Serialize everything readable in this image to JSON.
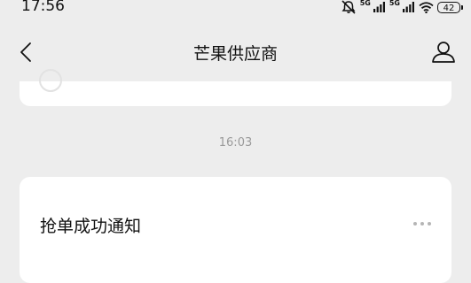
{
  "status_bar": {
    "time": "17:56",
    "network_1": "5G",
    "network_2": "5G",
    "battery": "42",
    "icons": [
      "mute-icon",
      "signal-icon",
      "signal-icon",
      "wifi-icon",
      "battery-icon"
    ]
  },
  "nav": {
    "title": "芒果供应商",
    "back_icon": "chevron-left-icon",
    "profile_icon": "person-icon"
  },
  "chat": {
    "timestamp": "16:03",
    "message": {
      "title": "抢单成功通知",
      "more_icon": "more-dots-icon"
    }
  }
}
